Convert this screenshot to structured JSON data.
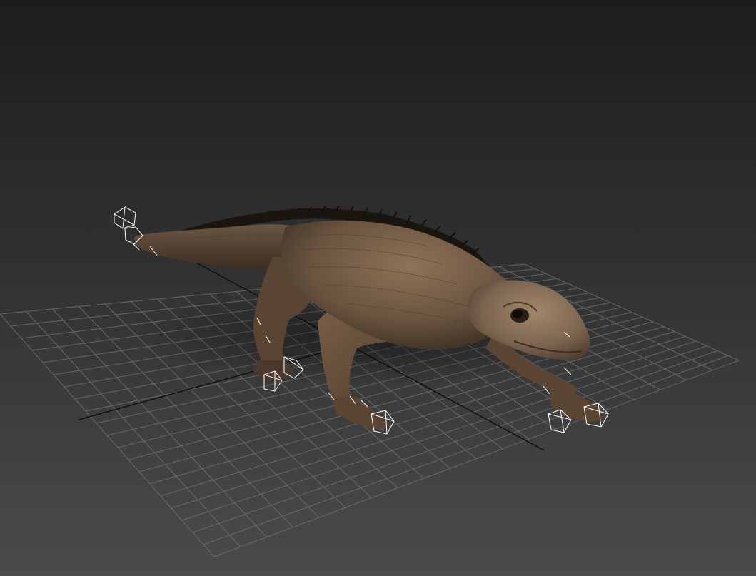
{
  "viewport": {
    "background_top": "#1e1e1e",
    "background_bottom": "#4a4a4a",
    "grid_color": "#6e6e6e",
    "axis_color": "#0c0c0c",
    "helper_color": "#ffffff"
  },
  "model": {
    "subject": "lizard-model",
    "skin_light": "#8e7458",
    "skin_mid": "#6b5540",
    "skin_dark": "#3e3024",
    "crest_color": "#1c1610"
  },
  "helpers": [
    "tail-tip-helper",
    "front-left-foot-helper",
    "front-right-foot-helper",
    "rear-left-foot-helper",
    "rear-right-foot-helper"
  ]
}
